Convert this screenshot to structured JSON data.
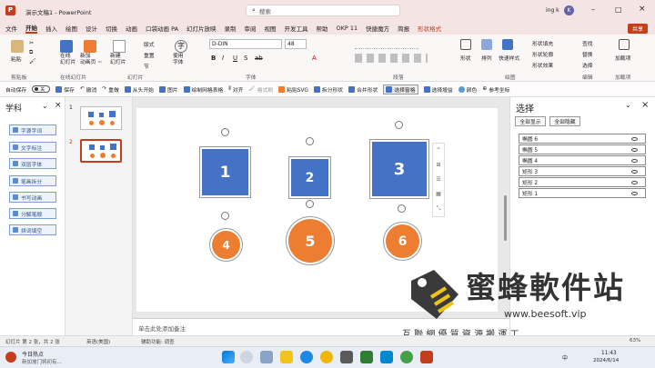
{
  "titlebar": {
    "autosave_label": "",
    "doc_title": "演示文稿1 - PowerPoint",
    "search_placeholder": "搜索",
    "user": "ing k",
    "avatar_letter": "K"
  },
  "tabs": [
    "文件",
    "开始",
    "插入",
    "绘图",
    "设计",
    "切换",
    "动画",
    "口袋动画 PA",
    "幻灯片放映",
    "录制",
    "审阅",
    "视图",
    "开发工具",
    "帮助",
    "OKP 11",
    "快捷魔方",
    "简报",
    "形状格式"
  ],
  "active_tab": "开始",
  "tab_shape_format": "形状格式",
  "share_button": "共享",
  "ribbon": {
    "paste": "粘贴",
    "clipboard": "剪贴板",
    "online_slide": "在线\n幻灯片",
    "new_animation": "新加\n动画页 ~",
    "online_group": "在线幻灯片",
    "new_slide": "新建\n幻灯片",
    "layout": "版式",
    "reset": "重置",
    "section": "节",
    "slides_group": "幻灯片",
    "font_name": "D-DIN",
    "font_size": "48",
    "font_group": "字体",
    "paragraph_group": "段落",
    "shapes": "形状",
    "arrange": "排列",
    "quick_styles": "快速样式",
    "shape_fill": "形状填充",
    "shape_outline": "形状轮廓",
    "shape_effects": "形状效果",
    "drawing_group": "绘图",
    "find": "查找",
    "replace": "替换",
    "select": "选择",
    "editing_group": "编辑",
    "addins": "加载项",
    "addins_group": "加载项",
    "style_word": "使用\n字体"
  },
  "qat": [
    "自动保存",
    "保存",
    "撤消",
    "重做",
    "从头开始",
    "图片",
    "绘制网格表格",
    "对齐",
    "格式刷",
    "粘贴SVG",
    "拆分形状",
    "合并形状",
    "选择窗格",
    "选择增益",
    "颜色",
    "参考坐标"
  ],
  "autosave_state": "关",
  "leftpanel": {
    "title": "学科",
    "buttons": [
      "字源字词",
      "文字标注",
      "双层字体",
      "笔画拆分",
      "书写动画",
      "分解笔顺",
      "拼词填空"
    ]
  },
  "thumbs": [
    "1",
    "2"
  ],
  "slide": {
    "shapes": [
      {
        "label": "1",
        "kind": "square"
      },
      {
        "label": "2",
        "kind": "square"
      },
      {
        "label": "3",
        "kind": "square"
      },
      {
        "label": "4",
        "kind": "circle"
      },
      {
        "label": "5",
        "kind": "circle"
      },
      {
        "label": "6",
        "kind": "circle"
      }
    ]
  },
  "notes_placeholder": "单击此处添加备注",
  "selection_pane": {
    "title": "选择",
    "show_all": "全部显示",
    "hide_all": "全部隐藏",
    "items": [
      "椭圆 6",
      "椭圆 5",
      "椭圆 4",
      "矩形 3",
      "矩形 2",
      "矩形 1"
    ]
  },
  "statusbar": {
    "slide_info": "幻灯片 第 2 张，共 2 张",
    "language": "英语(美国)",
    "accessibility": "辅助功能: 调查",
    "zoom": "63%"
  },
  "watermark": {
    "brand": "蜜蜂軟件站",
    "tagline": "互 聯 網 優 質 資 源 搬 運 工",
    "url": "www.beesoft.vip"
  },
  "taskbar": {
    "notif_title": "今日热点",
    "notif_sub": "新加坡门将初有...",
    "time": "11:43",
    "date": "2024/6/14",
    "lang": "中"
  },
  "colors": {
    "square": "#4472c4",
    "circle": "#ed7d31",
    "brand_accent": "#c43e1c"
  }
}
